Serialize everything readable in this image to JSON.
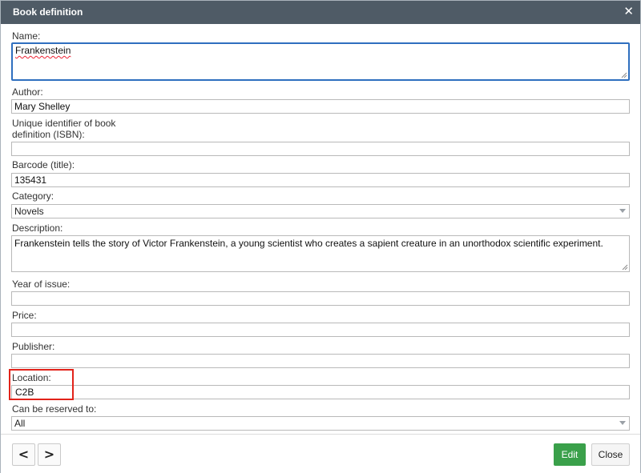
{
  "dialog": {
    "title": "Book definition",
    "close_icon": "close-icon"
  },
  "form": {
    "name": {
      "label": "Name:",
      "value": "Frankenstein"
    },
    "author": {
      "label": "Author:",
      "value": "Mary Shelley"
    },
    "isbn": {
      "label_line1": "Unique identifier of book",
      "label_line2": "definition (ISBN):",
      "value": ""
    },
    "barcode": {
      "label": "Barcode (title):",
      "value": "135431"
    },
    "category": {
      "label": "Category:",
      "value": "Novels"
    },
    "description": {
      "label": "Description:",
      "value": "Frankenstein tells the story of Victor Frankenstein, a young scientist who creates a sapient creature in an unorthodox scientific experiment."
    },
    "year": {
      "label": "Year of issue:",
      "value": ""
    },
    "price": {
      "label": "Price:",
      "value": ""
    },
    "publisher": {
      "label": "Publisher:",
      "value": ""
    },
    "location": {
      "label": "Location:",
      "value": "C2B"
    },
    "reserve": {
      "label": "Can be reserved to:",
      "value": "All"
    }
  },
  "footer": {
    "prev_label": "<",
    "next_label": ">",
    "edit_label": "Edit",
    "close_label": "Close"
  },
  "colors": {
    "titlebar": "#4f5b66",
    "edit_button": "#3aa04a",
    "highlight": "#e2231a",
    "focus_border": "#2f6fbf"
  }
}
